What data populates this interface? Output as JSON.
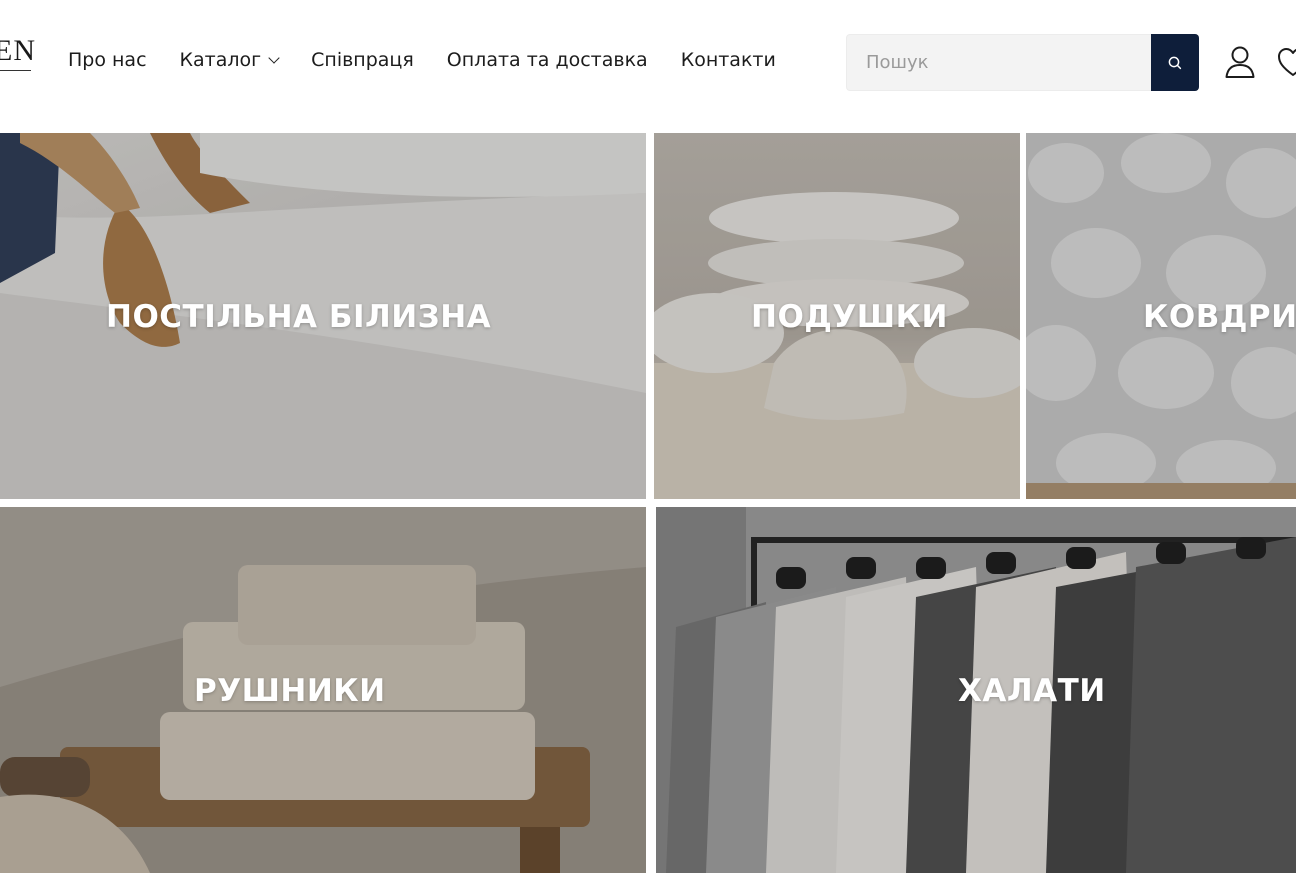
{
  "header": {
    "logo_text": "EN",
    "nav": [
      {
        "label": "Про нас"
      },
      {
        "label": "Каталог"
      },
      {
        "label": "Співпраця"
      },
      {
        "label": "Оплата та доставка"
      },
      {
        "label": "Контакти"
      }
    ],
    "search": {
      "placeholder": "Пошук",
      "button_icon": "search-icon"
    },
    "icons": [
      "user-icon",
      "heart-icon"
    ],
    "accent_color": "#0e1e3a"
  },
  "categories": [
    {
      "label": "ПОСТІЛЬНА БІЛИЗНА"
    },
    {
      "label": "ПОДУШКИ"
    },
    {
      "label": "КОВДРИ"
    },
    {
      "label": "РУШНИКИ"
    },
    {
      "label": "ХАЛАТИ"
    }
  ]
}
